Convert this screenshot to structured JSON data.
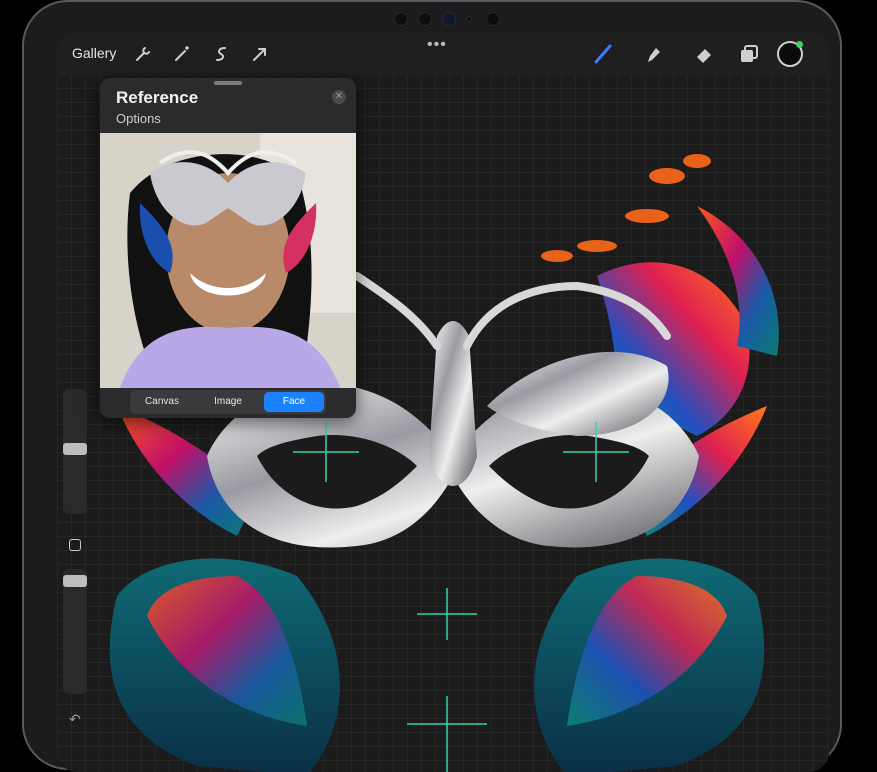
{
  "toolbar": {
    "gallery_label": "Gallery",
    "more_label": "•••",
    "icons": [
      "wrench-icon",
      "magic-wand-icon",
      "selection-icon",
      "transform-arrow-icon",
      "brush-icon",
      "smudge-icon",
      "eraser-icon",
      "layers-icon",
      "color-picker-icon"
    ],
    "brush_color": "#3a7bff",
    "active_color": "#0b0b0b"
  },
  "reference_panel": {
    "title": "Reference",
    "options_label": "Options",
    "close_icon": "close-icon",
    "tabs": [
      {
        "label": "Canvas",
        "active": false
      },
      {
        "label": "Image",
        "active": false
      },
      {
        "label": "Face",
        "active": true
      }
    ],
    "accent": "#1a82ff"
  },
  "sidebar": {
    "brush_size_level": 0.35,
    "opacity_level": 0.5,
    "undo_icon": "undo-icon"
  },
  "colors": {
    "guide": "#2fd6b0",
    "canvas_bg": "#1b1b1b"
  }
}
